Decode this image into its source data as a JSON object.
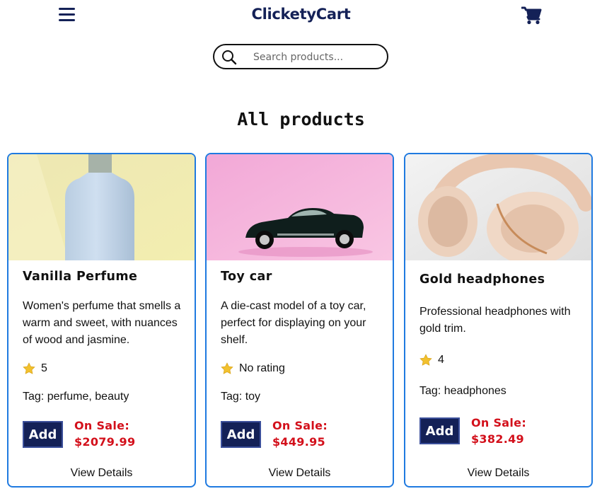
{
  "header": {
    "brand": "ClicketyCart",
    "menu_icon": "hamburger-menu-icon",
    "cart_icon": "shopping-cart-icon",
    "brand_color": "#142157"
  },
  "search": {
    "placeholder": "Search products...",
    "value": "",
    "icon": "search-icon"
  },
  "section": {
    "title": "All products"
  },
  "colors": {
    "card_border": "#1f7ae0",
    "button_bg": "#142157",
    "sale_text": "#d3101b"
  },
  "products": [
    {
      "image": "perfume-bottle-photo",
      "name": "Vanilla Perfume",
      "description": "Women's perfume that smells a warm and sweet, with nuances of wood and jasmine.",
      "rating": "5",
      "tags": "Tag: perfume, beauty",
      "add_label": "Add",
      "sale_label": "On Sale:",
      "price": "$2079.99",
      "details_label": "View Details"
    },
    {
      "image": "toy-car-photo",
      "name": "Toy car",
      "description": "A die-cast model of a toy car, perfect for displaying on your shelf.",
      "rating": "No rating",
      "tags": "Tag: toy",
      "add_label": "Add",
      "sale_label": "On Sale:",
      "price": "$449.95",
      "details_label": "View Details"
    },
    {
      "image": "gold-headphones-photo",
      "name": "Gold headphones",
      "description": "Professional headphones with gold trim.",
      "rating": "4",
      "tags": "Tag: headphones",
      "add_label": "Add",
      "sale_label": "On Sale:",
      "price": "$382.49",
      "details_label": "View Details"
    }
  ]
}
